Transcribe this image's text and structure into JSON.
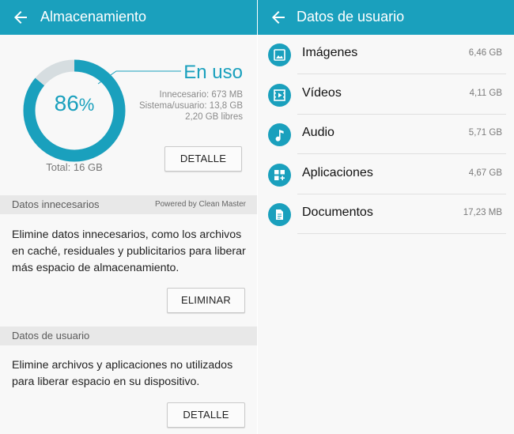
{
  "storage": {
    "title": "Almacenamiento",
    "percent_value": "86",
    "percent_symbol": "%",
    "used_fraction": 0.86,
    "in_use_label": "En uso",
    "unnecessary": "Innecesario: 673 MB",
    "system_user": "Sistema/usuario: 13,8 GB",
    "free": "2,20 GB libres",
    "total": "Total: 16 GB",
    "detail_button": "DETALLE",
    "unnecessary_section": {
      "header": "Datos innecesarios",
      "powered_by": "Powered by Clean Master",
      "lines": [
        "Elimine datos innecesarios, como los archivos",
        "en caché, residuales y publicitarios para liberar",
        "más espacio de almacenamiento."
      ],
      "button": "ELIMINAR"
    },
    "user_section": {
      "header": "Datos de usuario",
      "lines": [
        "Elimine archivos y aplicaciones no utilizados",
        "para liberar espacio en su dispositivo."
      ],
      "button": "DETALLE"
    }
  },
  "user_data": {
    "title": "Datos de usuario",
    "items": [
      {
        "label": "Imágenes",
        "size": "6,46 GB",
        "icon": "image-icon"
      },
      {
        "label": "Vídeos",
        "size": "4,11 GB",
        "icon": "video-icon"
      },
      {
        "label": "Audio",
        "size": "5,71 GB",
        "icon": "music-note-icon"
      },
      {
        "label": "Aplicaciones",
        "size": "4,67 GB",
        "icon": "apps-icon"
      },
      {
        "label": "Documentos",
        "size": "17,23 MB",
        "icon": "document-icon"
      }
    ]
  },
  "colors": {
    "accent": "#1aa0bd",
    "ring_remaining": "#d6dde0",
    "section_header_bg": "#e8e8e8"
  }
}
